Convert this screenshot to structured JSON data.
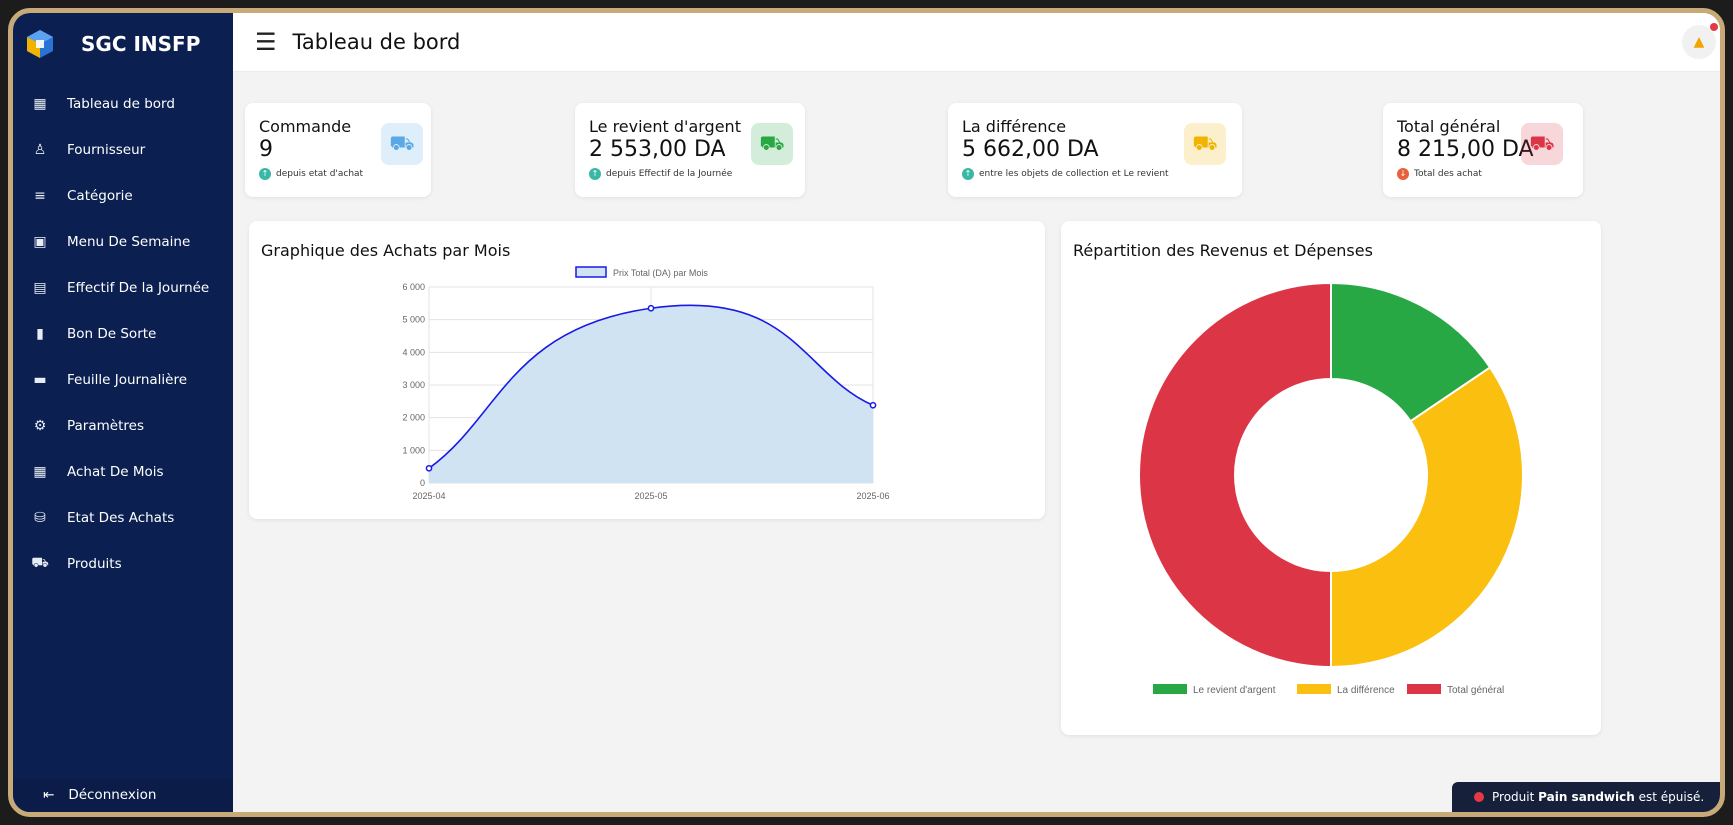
{
  "app": {
    "brand": "SGC INSFP",
    "page_title": "Tableau de bord"
  },
  "sidebar": {
    "items": [
      {
        "label": "Tableau de bord",
        "icon": "grid-icon"
      },
      {
        "label": "Fournisseur",
        "icon": "user-icon"
      },
      {
        "label": "Catégorie",
        "icon": "list-icon"
      },
      {
        "label": "Menu De Semaine",
        "icon": "calendar-icon"
      },
      {
        "label": "Effectif De la Journée",
        "icon": "clipboard-icon"
      },
      {
        "label": "Bon De Sorte",
        "icon": "bar-chart-icon"
      },
      {
        "label": "Feuille Journalière",
        "icon": "card-icon"
      },
      {
        "label": "Paramètres",
        "icon": "gear-icon"
      },
      {
        "label": "Achat De Mois",
        "icon": "grid-icon"
      },
      {
        "label": "Etat Des Achats",
        "icon": "database-icon"
      },
      {
        "label": "Produits",
        "icon": "cart-icon"
      }
    ],
    "logout": "Déconnexion"
  },
  "cards": [
    {
      "title": "Commande",
      "value": "9",
      "sub": "depuis etat d'achat",
      "color": "#5aa9e6",
      "icon": "cart-icon",
      "trend": "up"
    },
    {
      "title": "Le revient d'argent",
      "value": "2 553,00 DA",
      "sub": "depuis Effectif de la Journée",
      "color": "#28a745",
      "icon": "cart-icon",
      "trend": "up"
    },
    {
      "title": "La différence",
      "value": "5 662,00 DA",
      "sub": "entre les objets de collection et Le revient",
      "color": "#f0b400",
      "icon": "cart-icon",
      "trend": "up"
    },
    {
      "title": "Total général",
      "value": "8 215,00 DA",
      "sub": "Total des achat",
      "color": "#dc3545",
      "icon": "cart-icon",
      "trend": "down"
    }
  ],
  "line_panel": {
    "title": "Graphique des Achats par Mois"
  },
  "donut_panel": {
    "title": "Répartition des Revenus et Dépenses"
  },
  "chart_data": [
    {
      "type": "line",
      "legend": "Prix Total (DA) par Mois",
      "x": [
        "2025-04",
        "2025-05",
        "2025-06"
      ],
      "values": [
        450,
        5350,
        2380
      ],
      "ylim": [
        0,
        6000
      ],
      "yticks": [
        "0",
        "1 000",
        "2 000",
        "3 000",
        "4 000",
        "5 000",
        "6 000"
      ],
      "line_color": "#1a1ae6",
      "fill_color": "#cfe3f3",
      "grid": true,
      "legend_position": "top"
    },
    {
      "type": "pie",
      "labels": [
        "Le revient d'argent",
        "La différence",
        "Total général"
      ],
      "values": [
        2553,
        5662,
        8215
      ],
      "colors": [
        "#28a745",
        "#fbbf0f",
        "#dc3545"
      ],
      "legend_position": "bottom"
    }
  ],
  "toast": {
    "prefix": "Produit",
    "product": "Pain sandwich",
    "suffix": "est épuisé."
  }
}
